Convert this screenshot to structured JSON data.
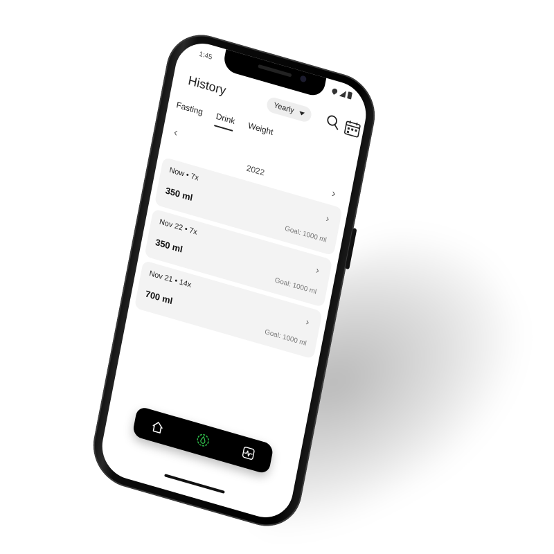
{
  "status_bar": {
    "time": "1:45"
  },
  "header": {
    "title": "History",
    "period_select": {
      "value": "Yearly"
    }
  },
  "tabs": [
    {
      "label": "Fasting",
      "active": false
    },
    {
      "label": "Drink",
      "active": true
    },
    {
      "label": "Weight",
      "active": false
    }
  ],
  "year_nav": {
    "prev_symbol": "‹",
    "next_symbol": "›",
    "year": "2022"
  },
  "entries": [
    {
      "date": "Now • 7x",
      "amount": "350 ml",
      "goal": "Goal: 1000 ml"
    },
    {
      "date": "Nov 22 • 7x",
      "amount": "350 ml",
      "goal": "Goal: 1000 ml"
    },
    {
      "date": "Nov 21 • 14x",
      "amount": "700 ml",
      "goal": "Goal: 1000 ml"
    }
  ],
  "bottom_nav": {
    "items": [
      {
        "icon": "home-icon",
        "active": false
      },
      {
        "icon": "drink-icon",
        "active": true
      },
      {
        "icon": "activity-icon",
        "active": false
      }
    ]
  },
  "colors": {
    "accent": "#2fbf4a",
    "card_background": "#f3f3f3",
    "bottom_nav_background": "#000000"
  }
}
